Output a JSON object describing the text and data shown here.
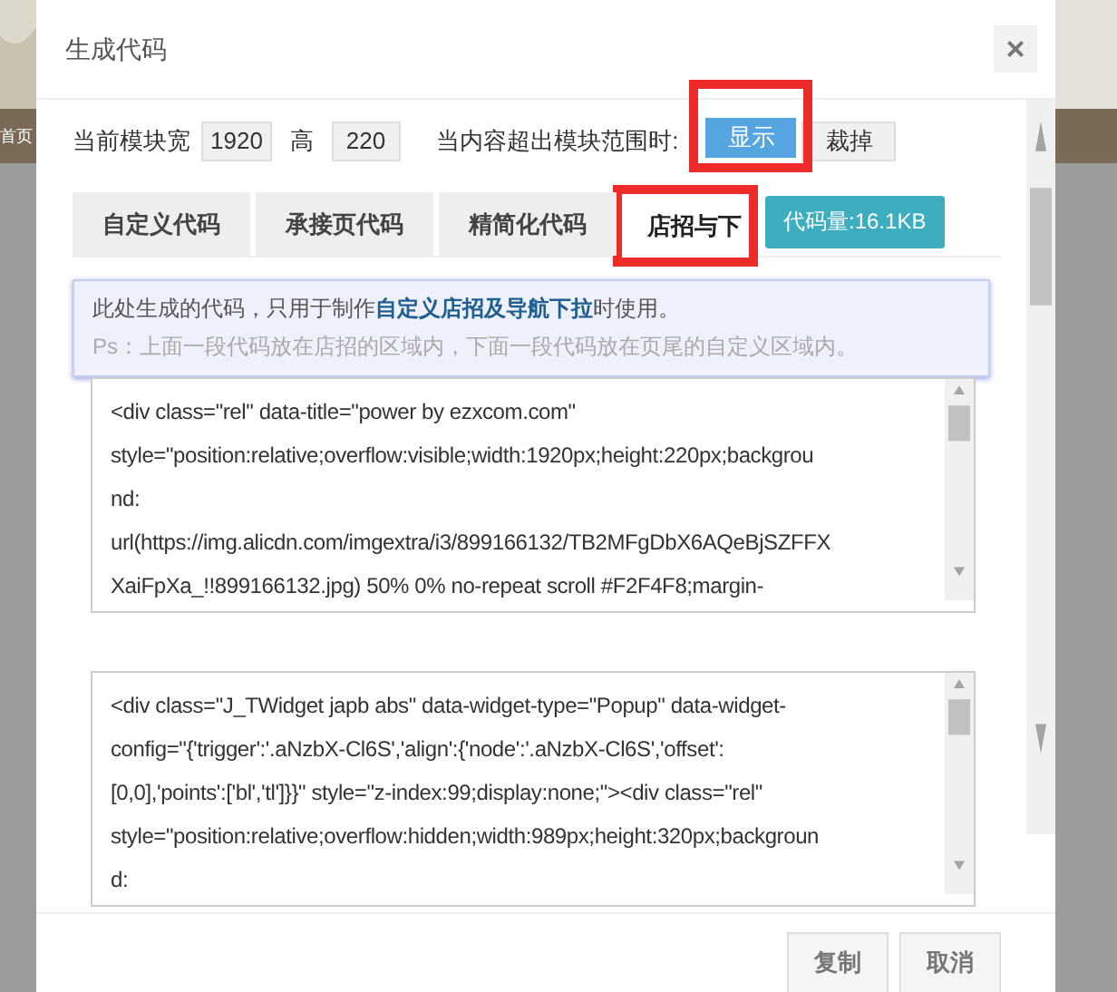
{
  "background": {
    "nav_text": "首页"
  },
  "dialog": {
    "title": "生成代码",
    "close": "×"
  },
  "size_row": {
    "width_label": "当前模块宽",
    "width_value": "1920",
    "height_label": "高",
    "height_value": "220",
    "overflow_label": "当内容超出模块范围时:",
    "options": [
      {
        "label": "显示",
        "selected": true
      },
      {
        "label": "裁掉",
        "selected": false
      }
    ]
  },
  "tabs": [
    {
      "label": "自定义代码",
      "selected": false
    },
    {
      "label": "承接页代码",
      "selected": false
    },
    {
      "label": "精简化代码",
      "selected": false
    },
    {
      "label": "店招与下",
      "selected": true
    }
  ],
  "code_size_badge": "代码量:16.1KB",
  "notice": {
    "line_1": "此处生成的代码，只用于制作**自定义店招及导航下拉**时使用。",
    "line_2": "Ps：上面一段代码放在店招的区域内，下面一段代码放在页尾的自定义区域内。"
  },
  "code_boxes": [
    {
      "lines": [
        "<div class=\"rel\" data-title=\"power by ezxcom.com\"",
        "style=\"position:relative;overflow:visible;width:1920px;height:220px;backgrou",
        "nd:",
        "url(https://img.alicdn.com/imgextra/i3/899166132/TB2MFgDbX6AQeBjSZFFX",
        "XaiFpXa_!!899166132.jpg) 50% 0% no-repeat scroll #F2F4F8;margin-"
      ]
    },
    {
      "lines": [
        "<div class=\"J_TWidget japb abs\" data-widget-type=\"Popup\" data-widget-",
        "config=\"{'trigger':'.aNzbX-Cl6S','align':{'node':'.aNzbX-Cl6S','offset':",
        "[0,0],'points':['bl','tl']}}\" style=\"z-index:99;display:none;\"><div class=\"rel\"",
        "style=\"position:relative;overflow:hidden;width:989px;height:320px;backgroun",
        "d:"
      ]
    }
  ],
  "footer": {
    "buttons": [
      "复制",
      "取消"
    ]
  }
}
